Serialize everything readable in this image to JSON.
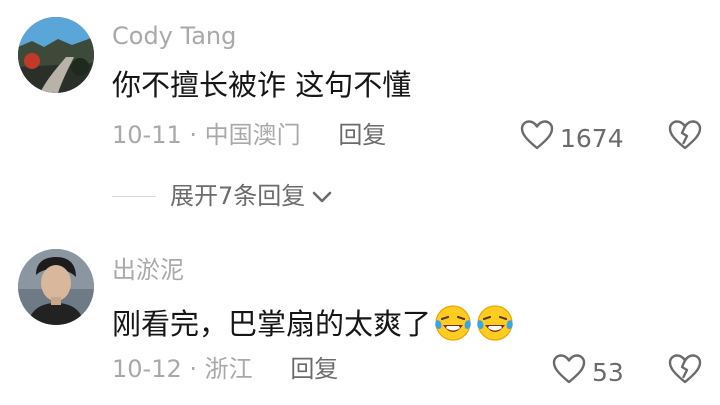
{
  "comments": [
    {
      "username": "Cody Tang",
      "text": "你不擅长被诈 这句不懂",
      "date": "10-11",
      "location": "中国澳门",
      "reply_label": "回复",
      "likes": "1674",
      "expand_label": "展开7条回复"
    },
    {
      "username": "出淤泥",
      "text": "刚看完，巴掌扇的太爽了",
      "emojis": [
        "laughing-crying-emoji",
        "laughing-crying-emoji"
      ],
      "date": "10-12",
      "location": "浙江",
      "reply_label": "回复",
      "likes": "53"
    }
  ],
  "icons": {
    "like": "heart-outline-icon",
    "dislike": "broken-heart-icon",
    "expand": "chevron-down-icon"
  },
  "colors": {
    "username": "#a9a9a9",
    "text": "#161616",
    "meta": "#a9a9a9",
    "action": "#6b6b6b"
  },
  "separator": "·"
}
